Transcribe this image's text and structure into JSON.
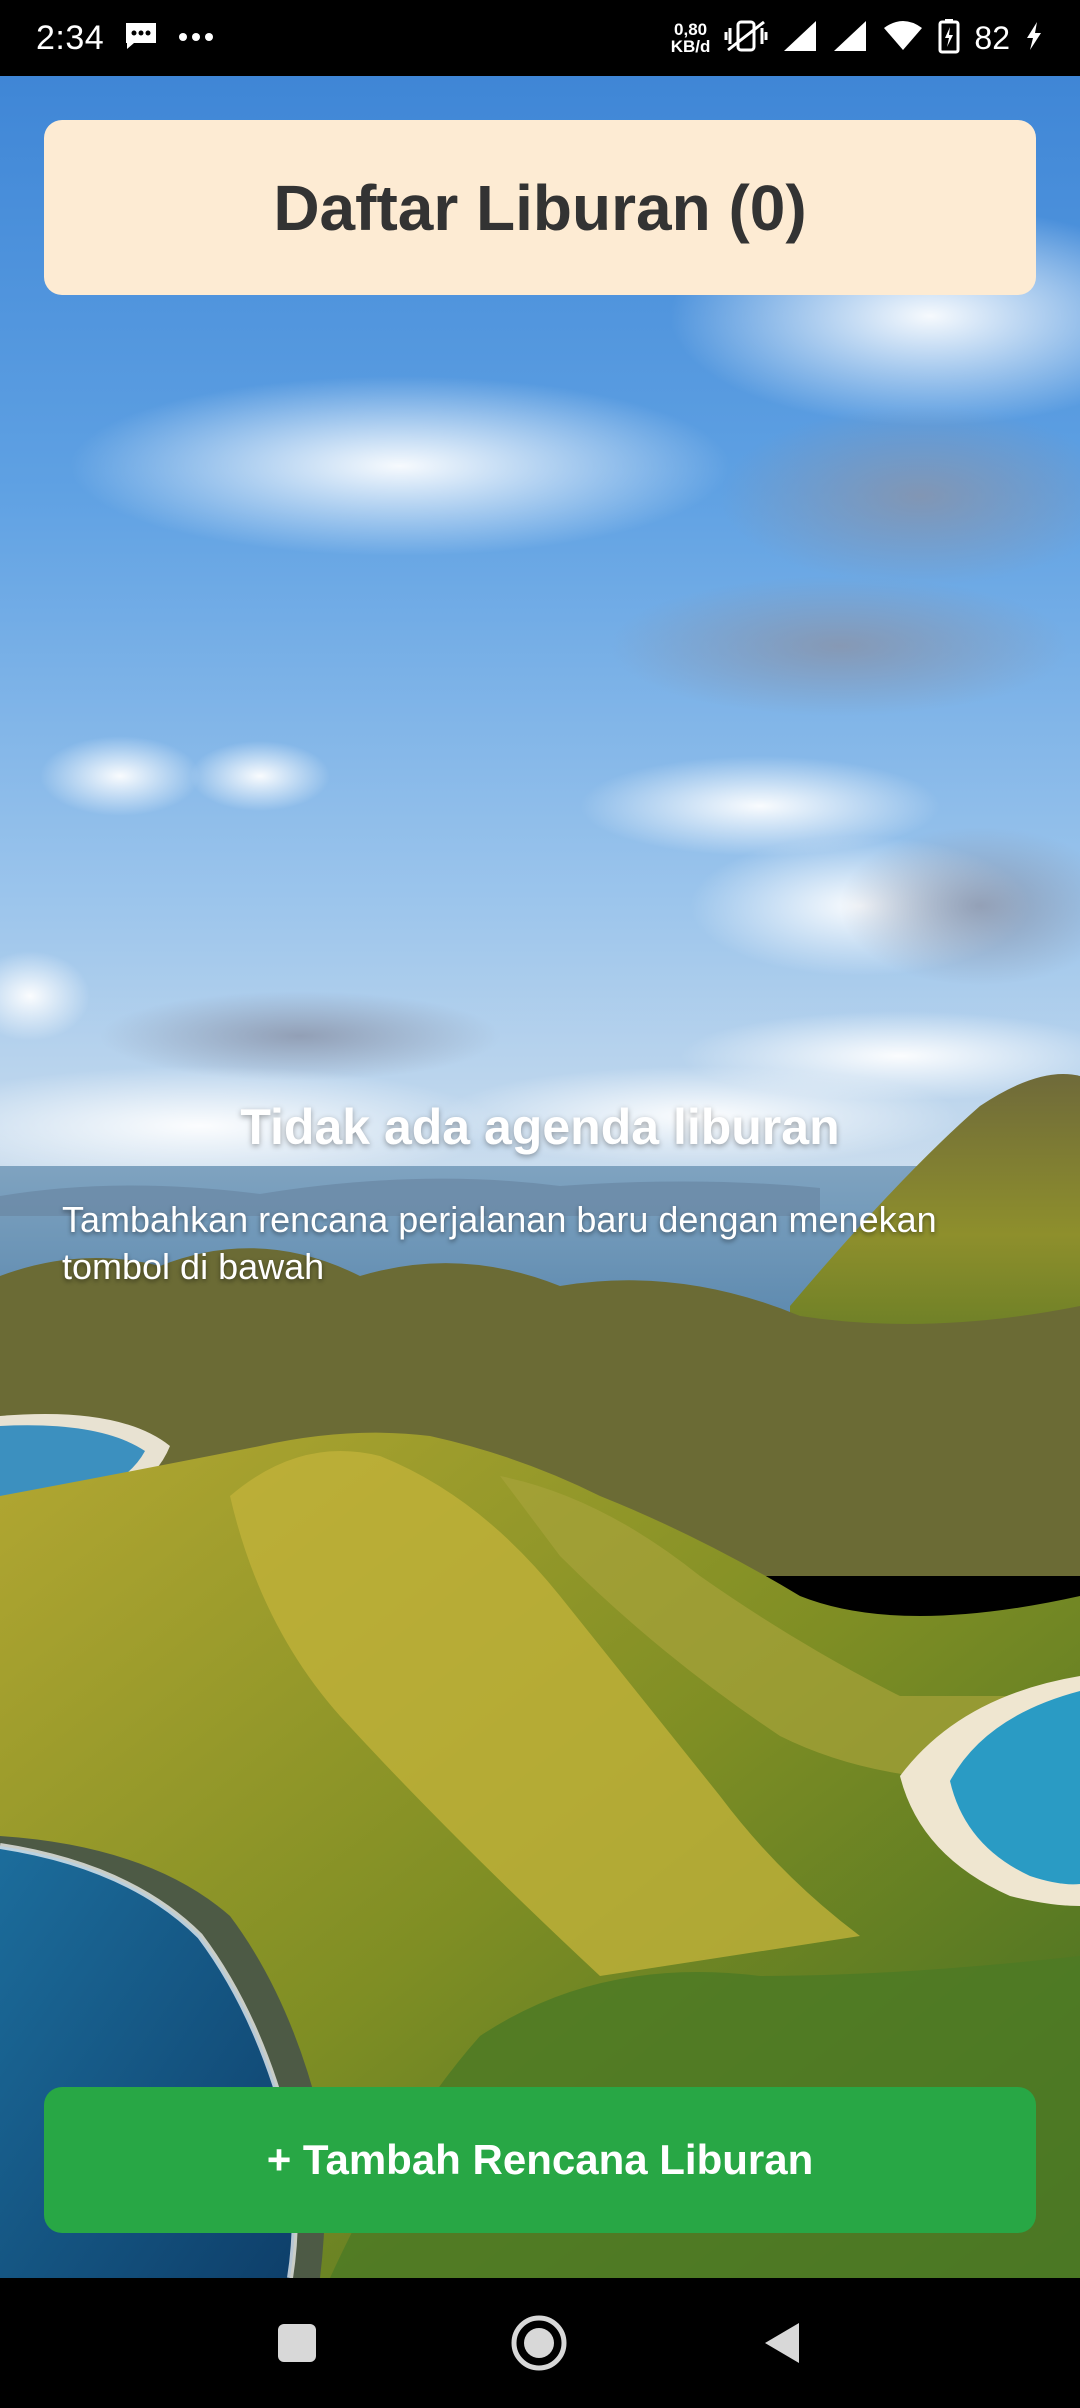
{
  "status_bar": {
    "time": "2:34",
    "net_speed_value": "0,80",
    "net_speed_unit": "KB/d",
    "battery_percent": "82",
    "icons": [
      "message-icon",
      "more-dots-icon",
      "vibrate-off-icon",
      "signal-icon",
      "signal-icon",
      "wifi-icon",
      "battery-icon",
      "charging-icon"
    ]
  },
  "header": {
    "title": "Daftar Liburan (0)"
  },
  "empty_state": {
    "title": "Tidak ada agenda liburan",
    "subtitle": "Tambahkan rencana perjalanan baru dengan menekan tombol di bawah"
  },
  "actions": {
    "add_button_label": "+ Tambah Rencana Liburan"
  },
  "colors": {
    "header_bg": "#fdebd3",
    "header_text": "#333333",
    "button_bg": "#28a745",
    "button_text": "#ffffff"
  },
  "nav_bar": {
    "icons": [
      "recents-square-icon",
      "home-circle-icon",
      "back-triangle-icon"
    ]
  }
}
